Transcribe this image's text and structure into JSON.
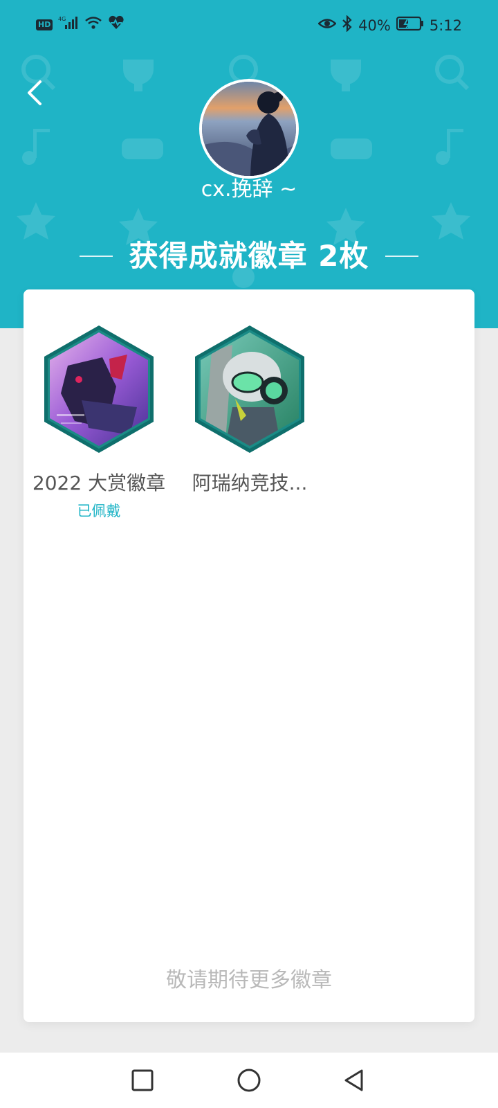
{
  "status_bar": {
    "left_icons": [
      "hd-icon",
      "signal-4g-icon",
      "wifi-icon",
      "heartbeat-icon"
    ],
    "hd_label": "HD",
    "net_label": "4G",
    "battery_percent": "40%",
    "time": "5:12",
    "right_icons": [
      "eye-icon",
      "bluetooth-icon",
      "battery-icon"
    ]
  },
  "header": {
    "username": "cx.挽辞 ~",
    "section_title": "获得成就徽章 2枚"
  },
  "badges": [
    {
      "name": "2022 大赏徽章",
      "status": "已佩戴",
      "icon": "award-2022-badge"
    },
    {
      "name": "阿瑞纳竞技...",
      "status": "",
      "icon": "arena-badge"
    }
  ],
  "footer_text": "敬请期待更多徽章",
  "colors": {
    "accent": "#1fb4c6",
    "card": "#ffffff",
    "background": "#ececec",
    "hex_border": "#0f6f6c"
  },
  "nav": {
    "buttons": [
      "recent-apps",
      "home",
      "back"
    ]
  }
}
